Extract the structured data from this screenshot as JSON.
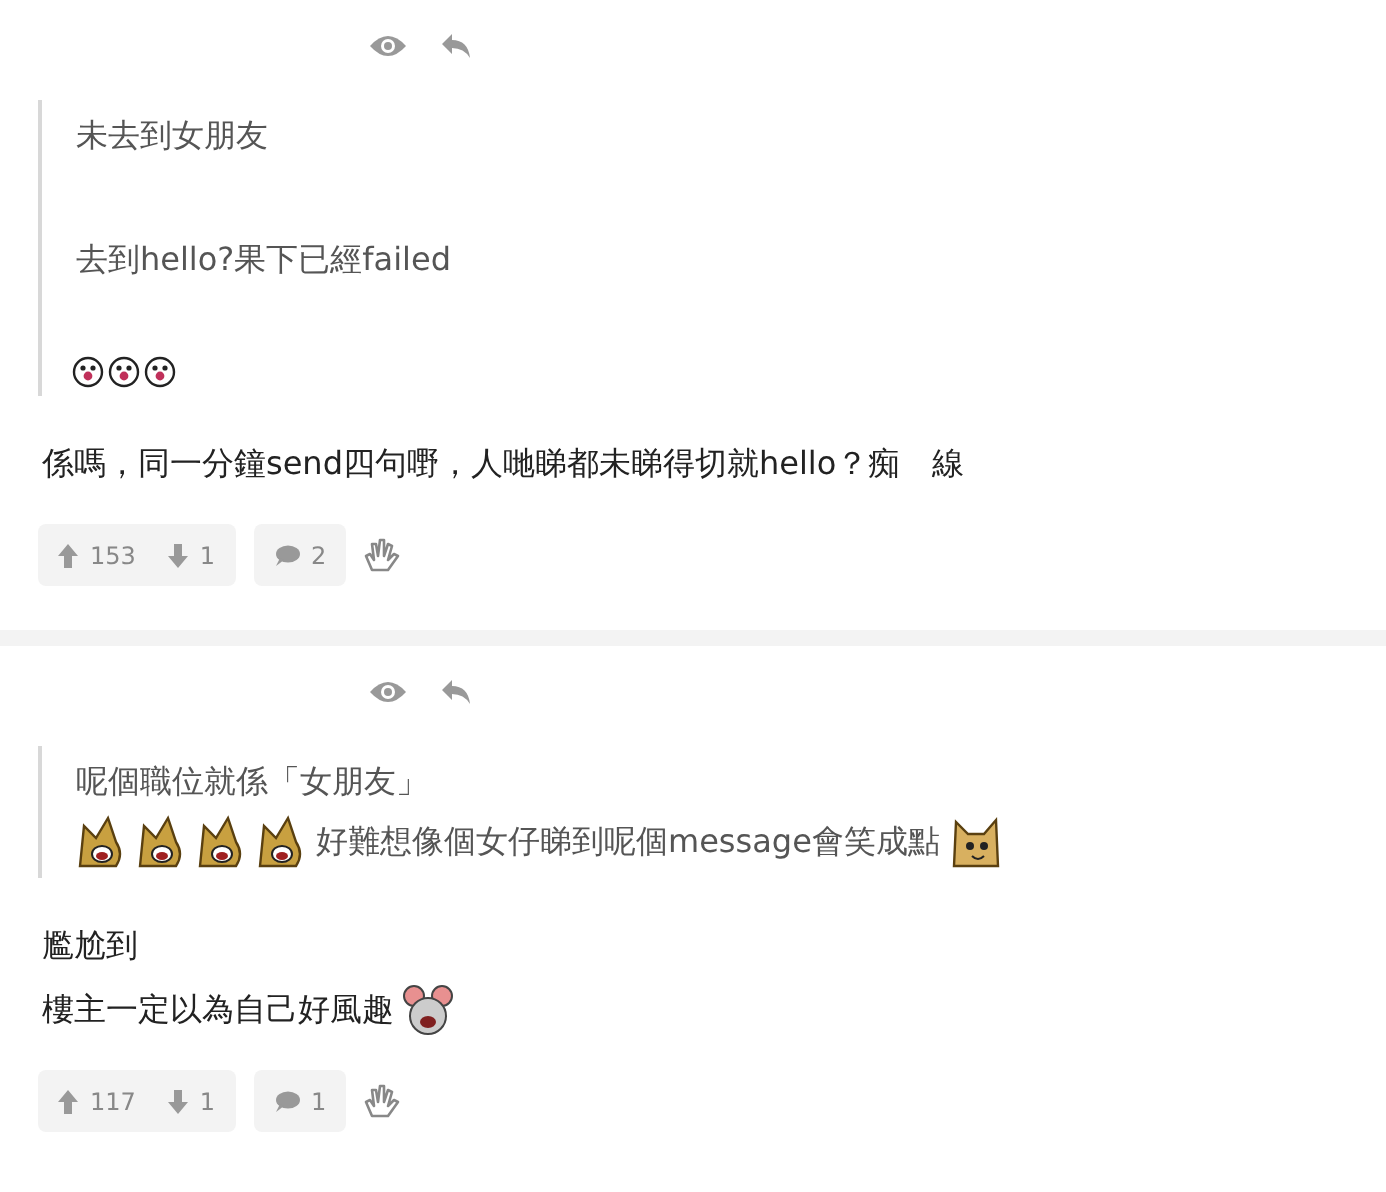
{
  "posts": [
    {
      "quote": [
        [
          {
            "kind": "text",
            "text": "未去到女朋友"
          }
        ],
        [
          {
            "kind": "text",
            "text": "去到hello?果下已經failed"
          }
        ],
        [
          {
            "kind": "clown"
          },
          {
            "kind": "clown"
          },
          {
            "kind": "clown"
          }
        ]
      ],
      "body": [
        [
          {
            "kind": "text",
            "text": "係嗎，同一分鐘send四句嘢，人哋睇都未睇得切就hello？痴　線"
          }
        ]
      ],
      "upvotes": "153",
      "downvotes": "1",
      "replies": "2"
    },
    {
      "quote": [
        [
          {
            "kind": "text",
            "text": "呢個職位就係「女朋友」"
          }
        ],
        [
          {
            "kind": "dog"
          },
          {
            "kind": "dog"
          },
          {
            "kind": "dog"
          },
          {
            "kind": "dog"
          },
          {
            "kind": "text",
            "text": "好難想像個女仔睇到呢個message會笑成點"
          },
          {
            "kind": "cat"
          }
        ]
      ],
      "body": [
        [
          {
            "kind": "text",
            "text": "尷尬到"
          }
        ],
        [
          {
            "kind": "text",
            "text": "樓主一定以為自己好風趣"
          },
          {
            "kind": "mouse"
          }
        ]
      ],
      "upvotes": "117",
      "downvotes": "1",
      "replies": "1"
    }
  ]
}
